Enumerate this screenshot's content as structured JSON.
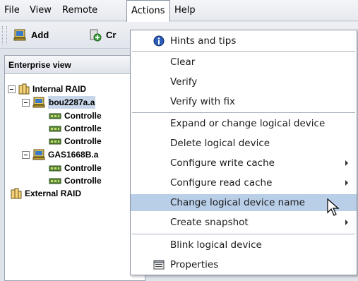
{
  "menubar": {
    "items": [
      {
        "label": "File"
      },
      {
        "label": "View"
      },
      {
        "label": "Remote"
      },
      {
        "label": "Actions"
      },
      {
        "label": "Help"
      }
    ]
  },
  "toolbar": {
    "add_label": "Add",
    "cr_label": "Cr"
  },
  "panel": {
    "title": "Enterprise view",
    "tree": [
      {
        "label": "Internal RAID"
      },
      {
        "label": "bou2287a.a"
      },
      {
        "label": "Controlle"
      },
      {
        "label": "Controlle"
      },
      {
        "label": "Controlle"
      },
      {
        "label": "GAS1668B.a"
      },
      {
        "label": "Controlle"
      },
      {
        "label": "Controlle"
      },
      {
        "label": "External RAID"
      }
    ]
  },
  "actions_menu": {
    "items": [
      {
        "label": "Hints and tips"
      },
      {
        "label": "Clear"
      },
      {
        "label": "Verify"
      },
      {
        "label": "Verify with fix"
      },
      {
        "label": "Expand or change logical device"
      },
      {
        "label": "Delete logical device"
      },
      {
        "label": "Configure write cache"
      },
      {
        "label": "Configure read cache"
      },
      {
        "label": "Change logical device name"
      },
      {
        "label": "Create snapshot"
      },
      {
        "label": "Blink logical device"
      },
      {
        "label": "Properties"
      }
    ],
    "highlighted": "Change logical device name"
  },
  "colors": {
    "highlight": "#b9cfe8",
    "selection": "#c8d6ea",
    "background": "#dfe3ea"
  },
  "icons": [
    "hints-icon",
    "properties-icon",
    "server-icon",
    "raid-icon",
    "controller-icon",
    "add-icon",
    "create-icon",
    "mouse-cursor-icon"
  ]
}
